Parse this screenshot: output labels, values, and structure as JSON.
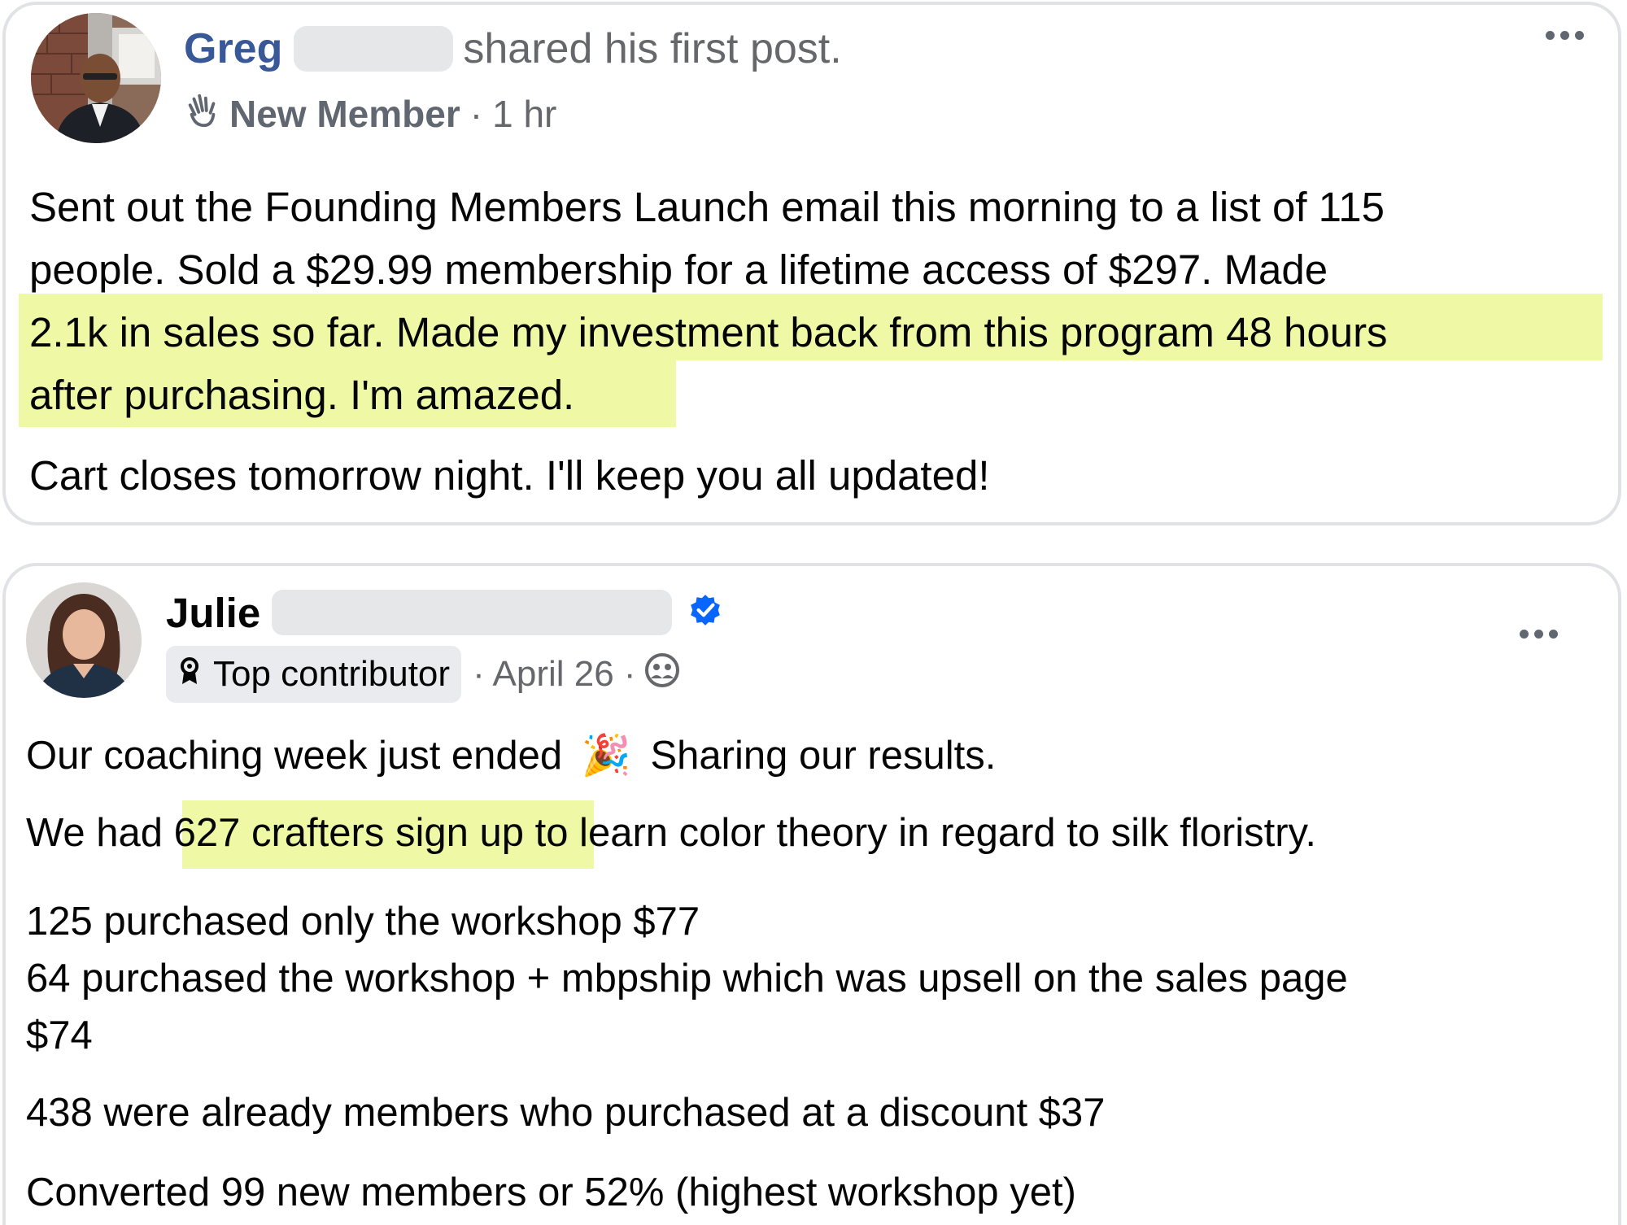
{
  "post1": {
    "author_first": "Greg",
    "action": "shared his first post.",
    "badge_label": "New Member",
    "separator": "·",
    "timestamp": "1 hr",
    "body_lines": [
      "Sent out the Founding Members Launch email this morning to a list of 115",
      "people. Sold a $29.99 membership for a lifetime access of $297. Made",
      "2.1k in sales so far. Made my investment back from this program 48 hours",
      "after purchasing. I'm amazed."
    ],
    "body_para2": "Cart closes tomorrow night. I'll keep you all updated!",
    "highlight_color": "#eff8a4",
    "link_color": "#385898",
    "icons": [
      "avatar-photo",
      "waving-hand-icon",
      "more-options-icon"
    ]
  },
  "post2": {
    "author_first": "Julie",
    "badge_label": "Top contributor",
    "date_prefix": "· April 26 ·",
    "line1_a": "Our coaching week just ended",
    "line1_emoji": "🎉",
    "line1_b": "Sharing our results.",
    "line2_pre": "We had ",
    "line2_highlight": "627 crafters sign up",
    "line2_post": " to learn color theory in regard to silk floristry.",
    "line3": "125 purchased only the workshop $77",
    "line4": "64 purchased the workshop + mbpship which was upsell on the sales page",
    "line5": "$74",
    "line6": "438 were already members who purchased at a discount $37",
    "line7": "Converted 99 new members or 52% (highest workshop yet)",
    "verified_color": "#0866ff",
    "icons": [
      "avatar-photo",
      "verified-badge-icon",
      "top-contributor-icon",
      "members-audience-icon",
      "more-options-icon"
    ]
  }
}
